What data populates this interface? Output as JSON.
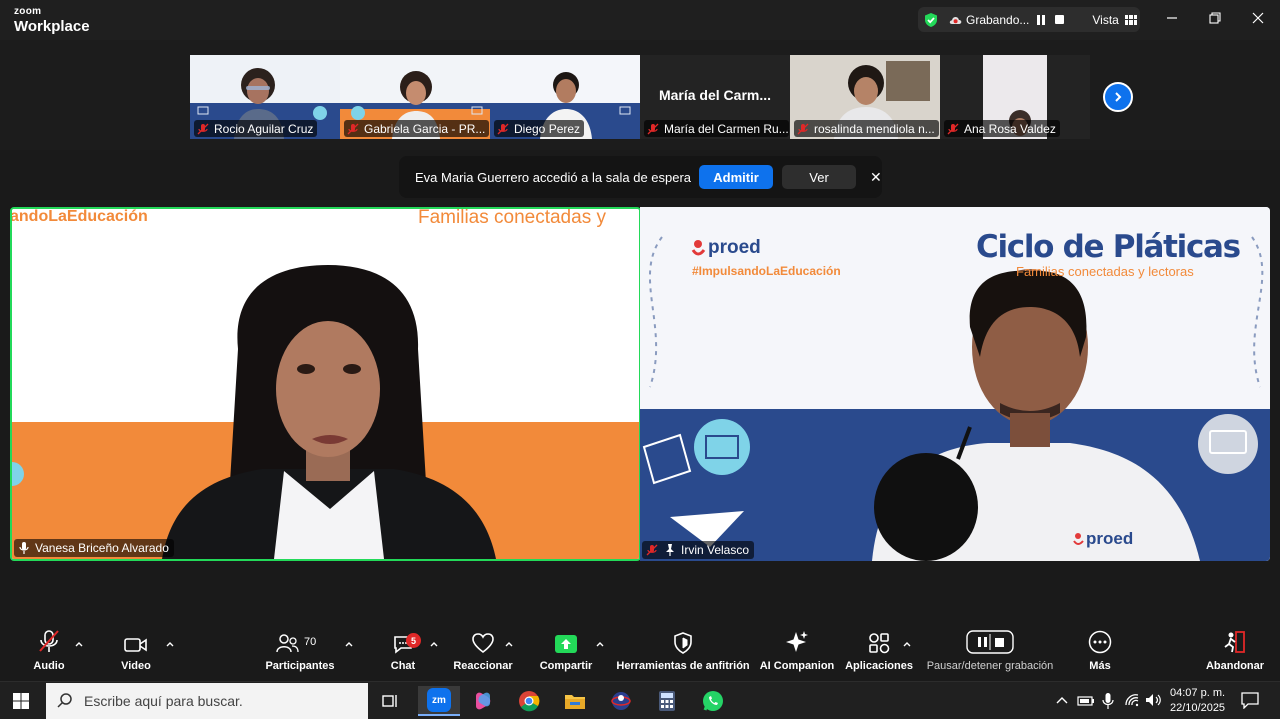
{
  "app": {
    "brand_small": "zoom",
    "brand_large": "Workplace"
  },
  "recording": {
    "status_text": "Grabando...",
    "view_label": "Vista"
  },
  "thumbnails": [
    {
      "label": "Rocio Aguilar Cruz",
      "muted": true
    },
    {
      "label": "Gabriela Garcia - PR...",
      "muted": true
    },
    {
      "label": "Diego Perez",
      "muted": true
    },
    {
      "label": "María del Carmen Ru...",
      "title": "María del Carm...",
      "muted": true
    },
    {
      "label": "rosalinda mendiola n...",
      "muted": true
    },
    {
      "label": "Ana Rosa Valdez",
      "muted": true
    }
  ],
  "waiting_room": {
    "message": "Eva Maria Guerrero accedió a la sala de espera",
    "admit_label": "Admitir",
    "view_label": "Ver"
  },
  "speakers": {
    "left": {
      "name": "Vanesa Briceño Alvarado",
      "banner_left": "andoLaEducación",
      "banner_right": "Familias conectadas y"
    },
    "right": {
      "name": "Irvin Velasco",
      "logo": "proed",
      "hashtag": "#ImpulsandoLaEducación",
      "title": "Ciclo de Pláticas",
      "subtitle": "Familias conectadas y lectoras",
      "shirt_logo": "proed"
    }
  },
  "toolbar": {
    "audio": "Audio",
    "video": "Video",
    "participants": "Participantes",
    "participants_count": "70",
    "chat": "Chat",
    "chat_badge": "5",
    "react": "Reaccionar",
    "share": "Compartir",
    "host_tools": "Herramientas de anfitrión",
    "ai_companion": "AI Companion",
    "apps": "Aplicaciones",
    "pause_rec": "Pausar/detener grabación",
    "more": "Más",
    "leave": "Abandonar"
  },
  "taskbar": {
    "search_placeholder": "Escribe aquí para buscar.",
    "zoom_label": "zm",
    "time": "04:07 p. m.",
    "date": "22/10/2025"
  },
  "colors": {
    "accent_blue": "#0e72ed",
    "speaker_green": "#23d959",
    "proed_orange": "#f28a3a",
    "proed_navy": "#2a4a8d",
    "leave_red": "#e02828"
  }
}
